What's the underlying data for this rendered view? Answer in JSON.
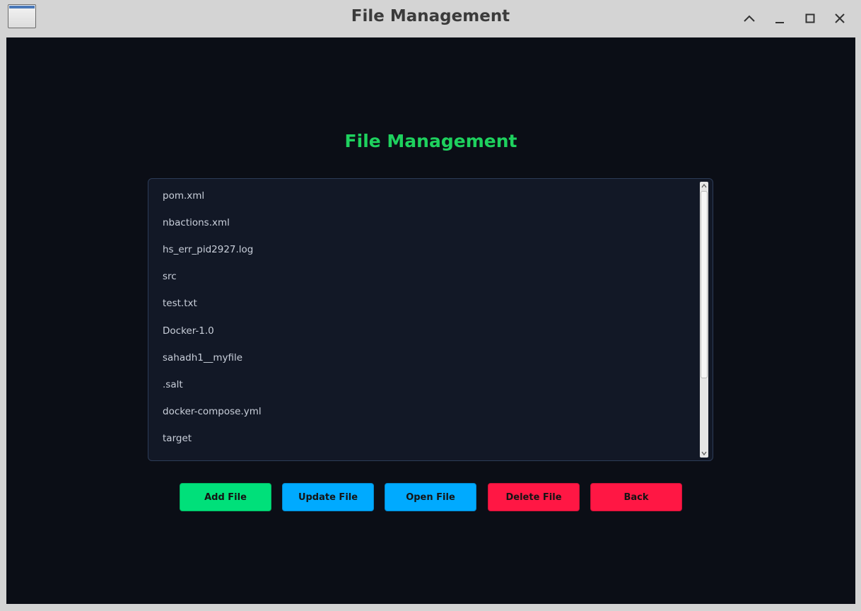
{
  "window": {
    "title": "File Management"
  },
  "page": {
    "heading": "File Management"
  },
  "files": [
    "pom.xml",
    "nbactions.xml",
    "hs_err_pid2927.log",
    "src",
    "test.txt",
    "Docker-1.0",
    "sahadh1__myfile",
    ".salt",
    "docker-compose.yml",
    "target"
  ],
  "buttons": {
    "add": "Add File",
    "update": "Update File",
    "open": "Open File",
    "delete": "Delete File",
    "back": "Back"
  },
  "colors": {
    "background": "#0b0e16",
    "list_background": "#121826",
    "heading": "#1ed15e",
    "add_button": "#00e07a",
    "update_button": "#00aaff",
    "open_button": "#00aaff",
    "delete_button": "#ff1744",
    "back_button": "#ff1744"
  },
  "icons": {
    "window_controls": [
      "collapse-up-icon",
      "minimize-icon",
      "maximize-icon",
      "close-icon"
    ],
    "scrollbar": [
      "scroll-up-icon",
      "scroll-down-icon"
    ]
  }
}
